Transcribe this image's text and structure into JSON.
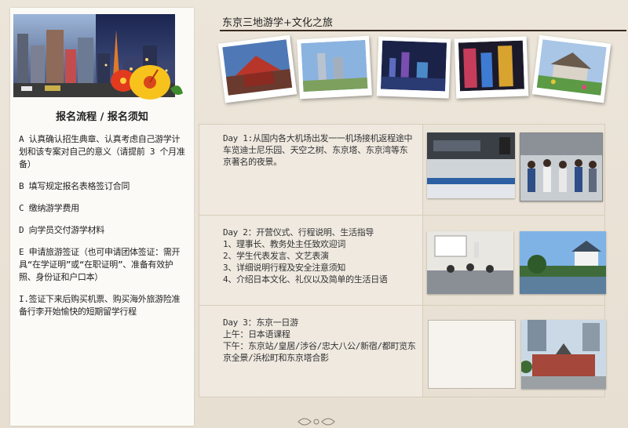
{
  "sidebar": {
    "title": "报名流程  / 报名须知",
    "steps": [
      "A 认真确认招生典章、认真考虑自己游学计划和该专案对自己的意义（请提前 3 个月准备）",
      "B 填写规定报名表格签订合同",
      "C 缴纳游学费用",
      "D 向学员交付游学材料",
      "E 申请旅游签证（也可申请团体签证：需开具“在学证明”或“在职证明”、准备有效护照、身份证和户口本）",
      "I.签证下来后购买机票、购买海外旅游险准备行李开始愉快的短期留学行程"
    ]
  },
  "main": {
    "title": "东京三地游学+文化之旅"
  },
  "itinerary": [
    {
      "lines": [
        "Day 1:从国内各大机场出发一一机场接机返程途中车览迪士尼乐园、天空之树、东京塔、东京湾等东京著名的夜景。"
      ]
    },
    {
      "lines": [
        "Day 2：开营仪式、行程说明、生活指导",
        "1、理事长、教务处主任致欢迎词",
        "2、学生代表发言、文艺表演",
        "3、详细说明行程及安全注意须知",
        "4、介绍日本文化、礼仪以及简单的生活日语"
      ]
    },
    {
      "lines": [
        "Day 3：东京一日游",
        "上午：日本语课程",
        "下午：东京站/皇居/涉谷/忠大八公/新宿/都町览东京全景/浜松町和东京塔合影"
      ]
    }
  ],
  "colors": {
    "accent_rule": "#3a2a20",
    "paper": "#efe9e0",
    "background": "#e9e1d4"
  }
}
